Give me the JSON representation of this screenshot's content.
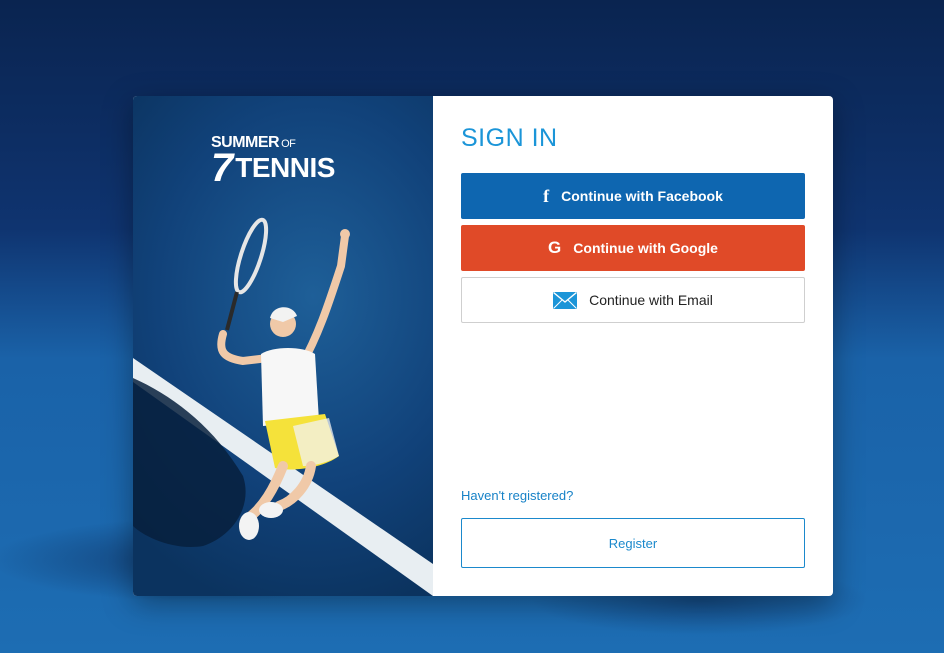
{
  "brand": {
    "logo_top": "SUMMER",
    "logo_of": "OF",
    "logo_seven": "7",
    "logo_word": "TENNIS"
  },
  "signin": {
    "title": "SIGN IN",
    "facebook_label": "Continue with Facebook",
    "google_label": "Continue with Google",
    "email_label": "Continue with Email",
    "facebook_icon": "f",
    "google_icon": "G"
  },
  "register": {
    "prompt": "Haven't registered?",
    "button_label": "Register"
  },
  "colors": {
    "accent": "#1b95d8",
    "facebook": "#0e66b0",
    "google": "#e04a28"
  },
  "icons": [
    "facebook-icon",
    "google-icon",
    "mail-icon"
  ]
}
